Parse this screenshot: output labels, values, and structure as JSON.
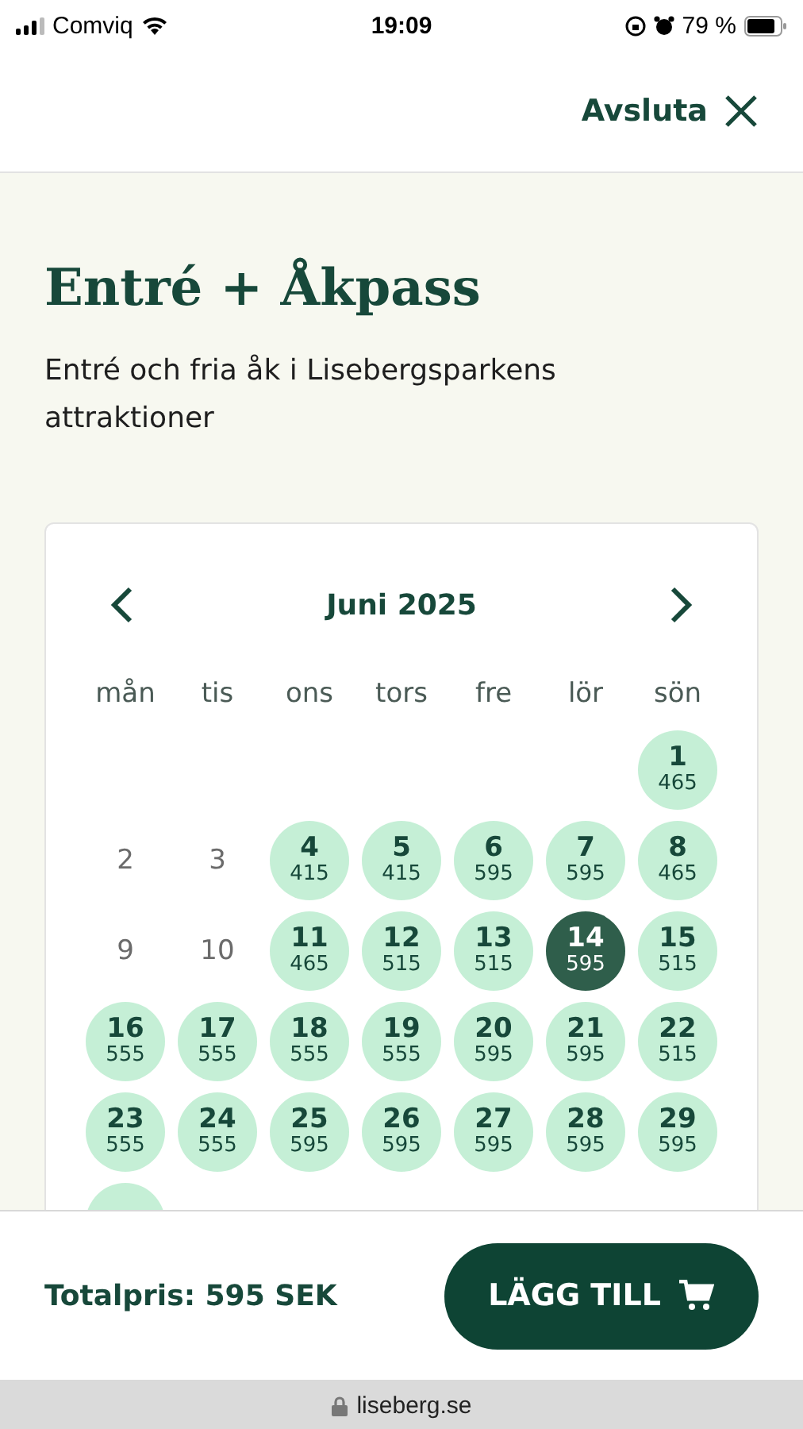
{
  "status_bar": {
    "carrier": "Comviq",
    "time": "19:09",
    "battery": "79 %"
  },
  "header": {
    "close_label": "Avsluta"
  },
  "title": "Entré + Åkpass",
  "subtitle": "Entré och fria åk i Lisebergsparkens attraktioner",
  "calendar": {
    "month": "Juni 2025",
    "weekdays": [
      "mån",
      "tis",
      "ons",
      "tors",
      "fre",
      "lör",
      "sön"
    ],
    "weeks": [
      [
        {
          "kind": "blank"
        },
        {
          "kind": "blank"
        },
        {
          "kind": "blank"
        },
        {
          "kind": "blank"
        },
        {
          "kind": "blank"
        },
        {
          "kind": "blank"
        },
        {
          "kind": "open",
          "day": "1",
          "price": "465",
          "selected": false
        }
      ],
      [
        {
          "kind": "closed",
          "day": "2",
          "selected": false
        },
        {
          "kind": "closed",
          "day": "3",
          "selected": false
        },
        {
          "kind": "open",
          "day": "4",
          "price": "415",
          "selected": false
        },
        {
          "kind": "open",
          "day": "5",
          "price": "415",
          "selected": false
        },
        {
          "kind": "open",
          "day": "6",
          "price": "595",
          "selected": false
        },
        {
          "kind": "open",
          "day": "7",
          "price": "595",
          "selected": false
        },
        {
          "kind": "open",
          "day": "8",
          "price": "465",
          "selected": false
        }
      ],
      [
        {
          "kind": "closed",
          "day": "9",
          "selected": false
        },
        {
          "kind": "closed",
          "day": "10",
          "selected": false
        },
        {
          "kind": "open",
          "day": "11",
          "price": "465",
          "selected": false
        },
        {
          "kind": "open",
          "day": "12",
          "price": "515",
          "selected": false
        },
        {
          "kind": "open",
          "day": "13",
          "price": "515",
          "selected": false
        },
        {
          "kind": "open",
          "day": "14",
          "price": "595",
          "selected": true
        },
        {
          "kind": "open",
          "day": "15",
          "price": "515",
          "selected": false
        }
      ],
      [
        {
          "kind": "open",
          "day": "16",
          "price": "555",
          "selected": false
        },
        {
          "kind": "open",
          "day": "17",
          "price": "555",
          "selected": false
        },
        {
          "kind": "open",
          "day": "18",
          "price": "555",
          "selected": false
        },
        {
          "kind": "open",
          "day": "19",
          "price": "555",
          "selected": false
        },
        {
          "kind": "open",
          "day": "20",
          "price": "595",
          "selected": false
        },
        {
          "kind": "open",
          "day": "21",
          "price": "595",
          "selected": false
        },
        {
          "kind": "open",
          "day": "22",
          "price": "515",
          "selected": false
        }
      ],
      [
        {
          "kind": "open",
          "day": "23",
          "price": "555",
          "selected": false
        },
        {
          "kind": "open",
          "day": "24",
          "price": "555",
          "selected": false
        },
        {
          "kind": "open",
          "day": "25",
          "price": "595",
          "selected": false
        },
        {
          "kind": "open",
          "day": "26",
          "price": "595",
          "selected": false
        },
        {
          "kind": "open",
          "day": "27",
          "price": "595",
          "selected": false
        },
        {
          "kind": "open",
          "day": "28",
          "price": "595",
          "selected": false
        },
        {
          "kind": "open",
          "day": "29",
          "price": "595",
          "selected": false
        }
      ],
      [
        {
          "kind": "open",
          "selected": false
        }
      ]
    ]
  },
  "footer": {
    "total": "Totalpris: 595 SEK",
    "button": "LÄGG TILL"
  },
  "browser": {
    "url": "liseberg.se"
  }
}
